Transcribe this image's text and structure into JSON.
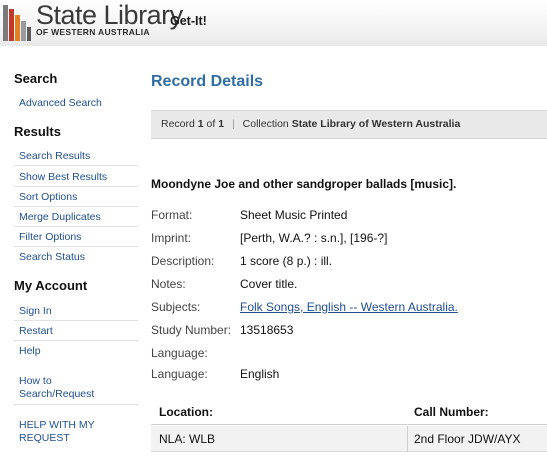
{
  "header": {
    "logo_title": "State Library",
    "logo_sub": "OF WESTERN AUSTRALIA",
    "getit": "Get-It!",
    "logo_colors": [
      "#c0392b",
      "#e67e22",
      "#8e8e8e",
      "#5a5a5a"
    ]
  },
  "sidebar": {
    "search_heading": "Search",
    "advanced_search": "Advanced Search",
    "results_heading": "Results",
    "results_links": [
      "Search Results",
      "Show Best Results",
      "Sort Options",
      "Merge Duplicates",
      "Filter Options",
      "Search Status"
    ],
    "account_heading": "My Account",
    "account_links": [
      "Sign In",
      "Restart",
      "Help"
    ],
    "how_to": "How to Search/Request",
    "help_request": "HELP WITH MY REQUEST"
  },
  "main": {
    "title": "Record Details",
    "record_bar": {
      "record_word": "Record",
      "current": "1",
      "of_word": "of",
      "total": "1",
      "collection_label": "Collection",
      "collection_value": "State Library of Western Australia"
    },
    "item_title": "Moondyne Joe and other sandgroper ballads [music].",
    "fields": [
      {
        "label": "Format:",
        "value": "Sheet Music Printed",
        "link": false
      },
      {
        "label": "Imprint:",
        "value": "[Perth, W.A.? : s.n.], [196-?]",
        "link": false
      },
      {
        "label": "Description:",
        "value": "1 score (8 p.) : ill.",
        "link": false
      },
      {
        "label": "Notes:",
        "value": "Cover title.",
        "link": false
      },
      {
        "label": "Subjects:",
        "value": "Folk Songs, English -- Western Australia.",
        "link": true
      },
      {
        "label": "Study Number:",
        "value": "13518653",
        "link": false
      },
      {
        "label": "Language:",
        "value": "",
        "link": false
      },
      {
        "label": "Language:",
        "value": "English",
        "link": false
      }
    ],
    "holdings": {
      "location_header": "Location:",
      "call_header": "Call Number:",
      "location_value": "NLA: WLB",
      "call_value": "2nd Floor JDW/AYX"
    }
  },
  "colors": {
    "accent_blue": "#2f6ea5",
    "link_blue": "#1f4f8f"
  }
}
